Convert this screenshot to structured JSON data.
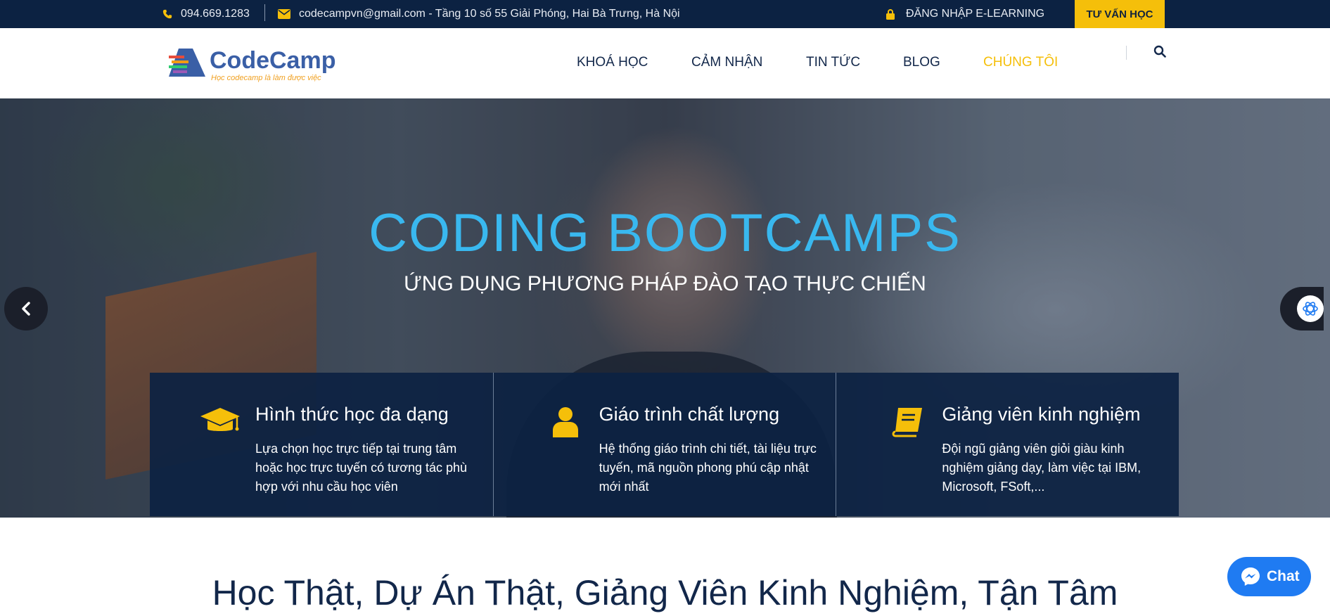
{
  "topbar": {
    "phone": "094.669.1283",
    "email_address": "codecampvn@gmail.com - Tầng 10 số 55 Giải Phóng, Hai Bà Trưng, Hà Nội",
    "login_label": "ĐĂNG NHẬP E-LEARNING",
    "consult_label": "TƯ VẤN HỌC"
  },
  "logo": {
    "name": "CodeCamp",
    "slogan": "Học codecamp là làm được việc"
  },
  "nav": {
    "items": [
      {
        "label": "KHOÁ HỌC"
      },
      {
        "label": "CẢM NHẬN"
      },
      {
        "label": "TIN TỨC"
      },
      {
        "label": "BLOG"
      },
      {
        "label": "CHÚNG TÔI",
        "active": true
      }
    ]
  },
  "hero": {
    "title": "CODING BOOTCAMPS",
    "subtitle": "ỨNG DỤNG PHƯƠNG PHÁP ĐÀO TẠO THỰC CHIẾN"
  },
  "features": [
    {
      "icon": "graduation-cap-icon",
      "title": "Hình thức học đa dạng",
      "desc": "Lựa chọn học trực tiếp tại trung tâm hoặc học trực tuyến có tương tác phù hợp với nhu cầu học viên"
    },
    {
      "icon": "user-icon",
      "title": "Giáo trình chất lượng",
      "desc": "Hệ thống giáo trình chi tiết, tài liệu trực tuyến, mã nguồn phong phú cập nhật mới nhất"
    },
    {
      "icon": "book-icon",
      "title": "Giảng viên kinh nghiệm",
      "desc": "Đội ngũ giảng viên giỏi giàu kinh nghiệm giảng dạy, làm việc tại IBM, Microsoft, FSoft,..."
    }
  ],
  "section": {
    "title": "Học Thật, Dự Án Thật, Giảng Viên Kinh Nghiệm, Tận Tâm"
  },
  "chat": {
    "label": "Chat"
  },
  "colors": {
    "topbar_bg": "#0c2242",
    "accent_yellow": "#f5bf0a",
    "hero_title": "#39b8ef",
    "feature_bg": "#0c2242",
    "chat_blue": "#1f7bf2"
  }
}
